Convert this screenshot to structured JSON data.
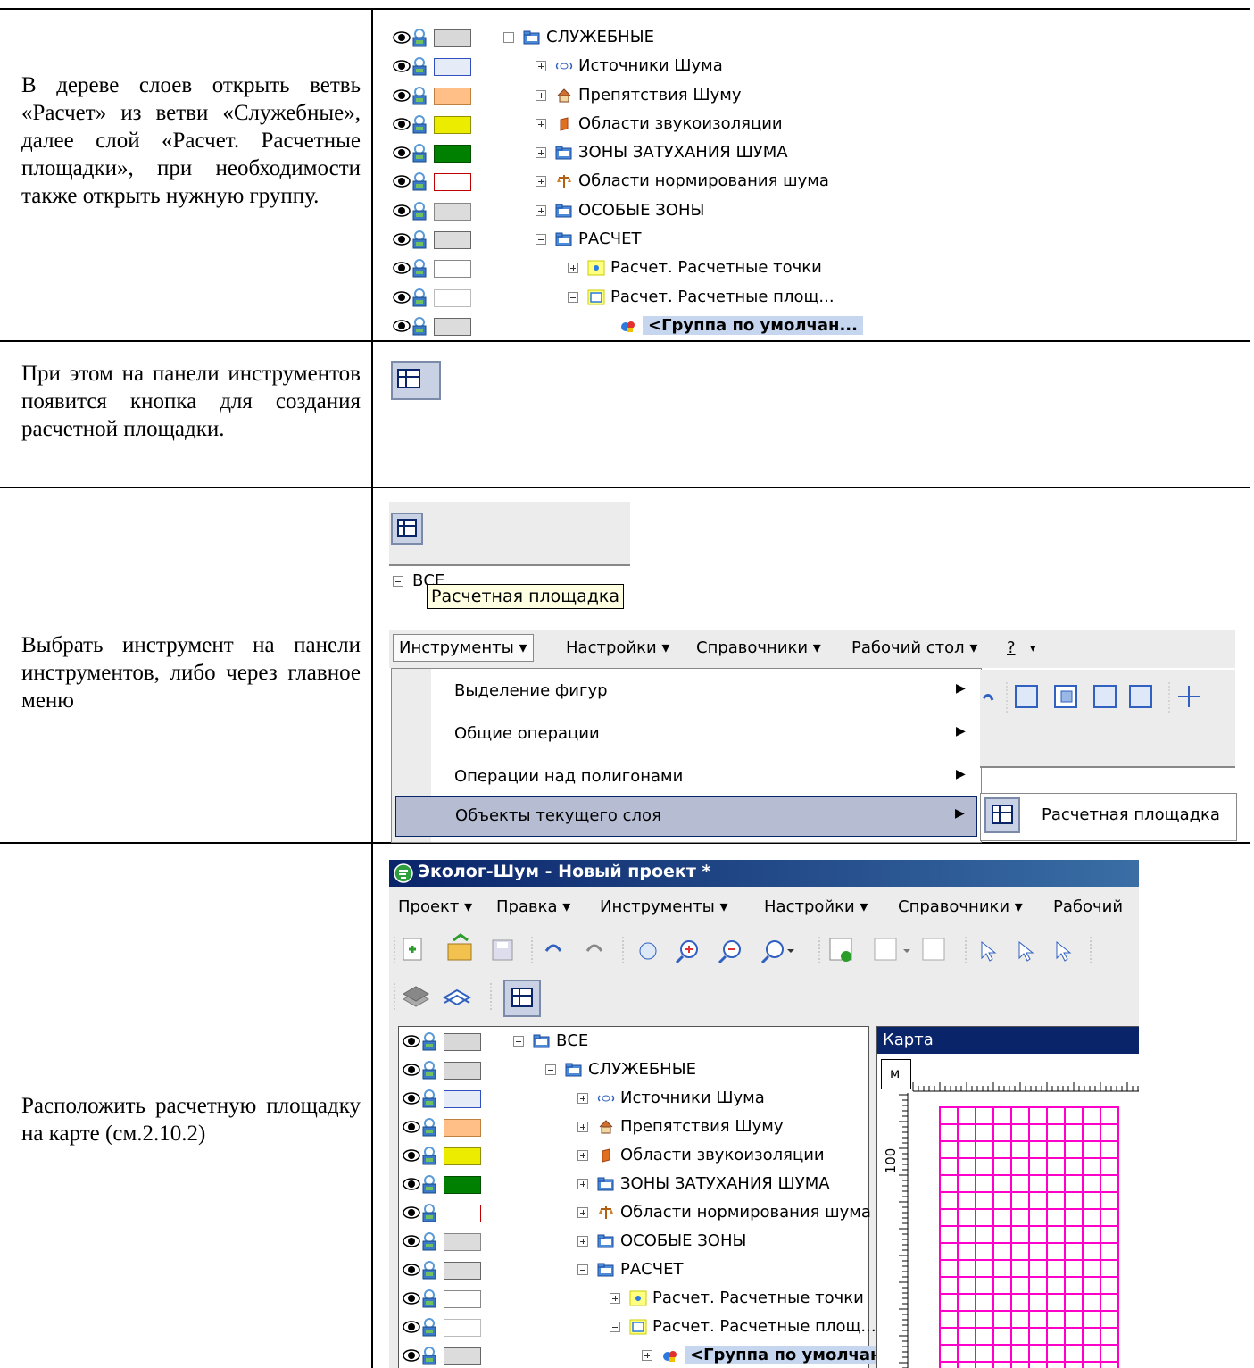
{
  "rows": [
    {
      "instruction": "В дереве слоев открыть ветвь «Расчет» из ветви «Служебные», далее слой «Расчет. Расчетные площадки», при необходимости также открыть нужную группу."
    },
    {
      "instruction": "При этом на панели инструментов появится кнопка для создания расчетной площадки."
    },
    {
      "instruction": "Выбрать инструмент на панели инструментов, либо через главное меню"
    },
    {
      "instruction": "Расположить расчетную площадку на карте (см.2.10.2)"
    }
  ],
  "tree1": [
    {
      "label": "СЛУЖЕБНЫЕ",
      "expander": "minus",
      "icon": "folder-icon",
      "swatch_fill": "#d8d8d8",
      "swatch_border": "#666666",
      "indent": 0
    },
    {
      "label": "Источники Шума",
      "expander": "plus",
      "icon": "noise-source-icon",
      "swatch_fill": "#e6ebf8",
      "swatch_border": "#3050c0",
      "indent": 1
    },
    {
      "label": "Препятствия Шуму",
      "expander": "plus",
      "icon": "house-icon",
      "swatch_fill": "#ffbf86",
      "swatch_border": "#c08040",
      "indent": 1
    },
    {
      "label": "Области звукоизоляции",
      "expander": "plus",
      "icon": "insulation-icon",
      "swatch_fill": "#ecec00",
      "swatch_border": "#909000",
      "indent": 1
    },
    {
      "label": "ЗОНЫ ЗАТУХАНИЯ ШУМА",
      "expander": "plus",
      "icon": "folder-icon",
      "swatch_fill": "#008000",
      "swatch_border": "#005000",
      "indent": 1
    },
    {
      "label": "Области нормирования шума",
      "expander": "plus",
      "icon": "scales-icon",
      "swatch_fill": "#ffffff",
      "swatch_border": "#c00000",
      "indent": 1
    },
    {
      "label": "ОСОБЫЕ ЗОНЫ",
      "expander": "plus",
      "icon": "folder-icon",
      "swatch_fill": "#dcdcdc",
      "swatch_border": "#888888",
      "indent": 1
    },
    {
      "label": "РАСЧЕТ",
      "expander": "minus",
      "icon": "folder-icon",
      "swatch_fill": "#dcdcdc",
      "swatch_border": "#666666",
      "indent": 1
    },
    {
      "label": "Расчет. Расчетные точки",
      "expander": "plus",
      "icon": "calc-point-icon",
      "swatch_fill": "#ffffff",
      "swatch_border": "#888888",
      "indent": 2
    },
    {
      "label": "Расчет. Расчетные площ...",
      "expander": "minus",
      "icon": "calc-area-icon",
      "swatch_fill": "#ffffff",
      "swatch_border": "#bbbbbb",
      "indent": 2
    },
    {
      "label": "<Группа по умолчан...",
      "expander": "none",
      "icon": "group-icon",
      "swatch_fill": "#dcdcdc",
      "swatch_border": "#666666",
      "indent": 3,
      "selected": true
    }
  ],
  "row3": {
    "tooltip": "Расчетная площадка",
    "tree_root": "ВСЕ",
    "menu": [
      "Инструменты ▾",
      "Настройки ▾",
      "Справочники ▾",
      "Рабочий стол ▾",
      "?"
    ],
    "dropdown": [
      "Выделение фигур",
      "Общие операции",
      "Операции над полигонами",
      "Объекты текущего слоя"
    ],
    "submenu": "Расчетная площадка"
  },
  "row4": {
    "window_title": "Эколог-Шум - Новый проект *",
    "menu": [
      "Проект ▾",
      "Правка ▾",
      "Инструменты ▾",
      "Настройки ▾",
      "Справочники ▾",
      "Рабочий"
    ],
    "map_title": "Карта",
    "ruler_unit": "м",
    "ruler_tick": "100",
    "root": "ВСЕ"
  },
  "colors": {
    "accent": "#0a246a",
    "selection": "#c5d6ee",
    "grid": "#ff00cc",
    "menu_highlight": "#b6bdd2"
  }
}
